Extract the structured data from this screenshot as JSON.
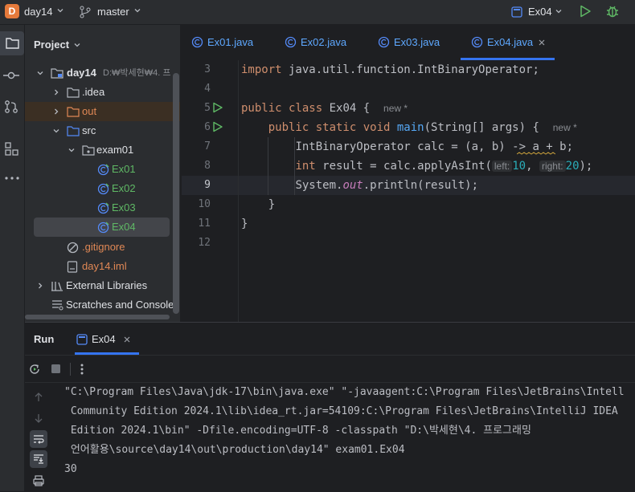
{
  "titlebar": {
    "project_badge": "D",
    "project_name": "day14",
    "branch": "master",
    "run_config": "Ex04"
  },
  "project_panel": {
    "title": "Project",
    "tree": [
      {
        "label": "day14",
        "suffix": "D:₩박세현₩4. 프"
      },
      {
        "label": ".idea"
      },
      {
        "label": "out"
      },
      {
        "label": "src"
      },
      {
        "label": "exam01"
      },
      {
        "label": "Ex01"
      },
      {
        "label": "Ex02"
      },
      {
        "label": "Ex03"
      },
      {
        "label": "Ex04"
      },
      {
        "label": ".gitignore"
      },
      {
        "label": "day14.iml"
      },
      {
        "label": "External Libraries"
      },
      {
        "label": "Scratches and Consoles"
      }
    ]
  },
  "editor": {
    "tabs": [
      "Ex01.java",
      "Ex02.java",
      "Ex03.java",
      "Ex04.java"
    ],
    "active_tab": "Ex04.java",
    "line_numbers": [
      "3",
      "4",
      "5",
      "6",
      "7",
      "8",
      "9",
      "10",
      "11",
      "12"
    ],
    "code": {
      "l3_kw": "import",
      "l3_rest": " java.util.function.IntBinaryOperator;",
      "l5_kw": "public class",
      "l5_name": " Ex04 {",
      "l5_hint": "new *",
      "l6_kw": "public static void",
      "l6_fn": "main",
      "l6_rest": "(String[] args) {",
      "l6_hint": "new *",
      "l7": "IntBinaryOperator calc = (a, b) -> a + b;",
      "l8_kw": "int",
      "l8_mid": " result = calc.applyAsInt(",
      "l8_hint_left": "left:",
      "l8_val1": "10",
      "l8_comma": ", ",
      "l8_hint_right": "right:",
      "l8_val2": "20",
      "l8_end": ");",
      "l9_a": "System.",
      "l9_out": "out",
      "l9_b": ".println(result);",
      "l10": "}",
      "l11": "}"
    }
  },
  "run_panel": {
    "title": "Run",
    "tab": "Ex04",
    "console": [
      "\"C:\\Program Files\\Java\\jdk-17\\bin\\java.exe\" \"-javaagent:C:\\Program Files\\JetBrains\\Intell",
      " Community Edition 2024.1\\lib\\idea_rt.jar=54109:C:\\Program Files\\JetBrains\\IntelliJ IDEA",
      " Edition 2024.1\\bin\" -Dfile.encoding=UTF-8 -classpath \"D:\\박세현\\4. 프로그래밍",
      " 언어활용\\source\\day14\\out\\production\\day14\" exam01.Ex04",
      "30"
    ]
  },
  "colors": {
    "accent": "#3574f0",
    "keyword": "#cf8e6d",
    "number": "#2aacb8",
    "run_green": "#5fb865"
  }
}
